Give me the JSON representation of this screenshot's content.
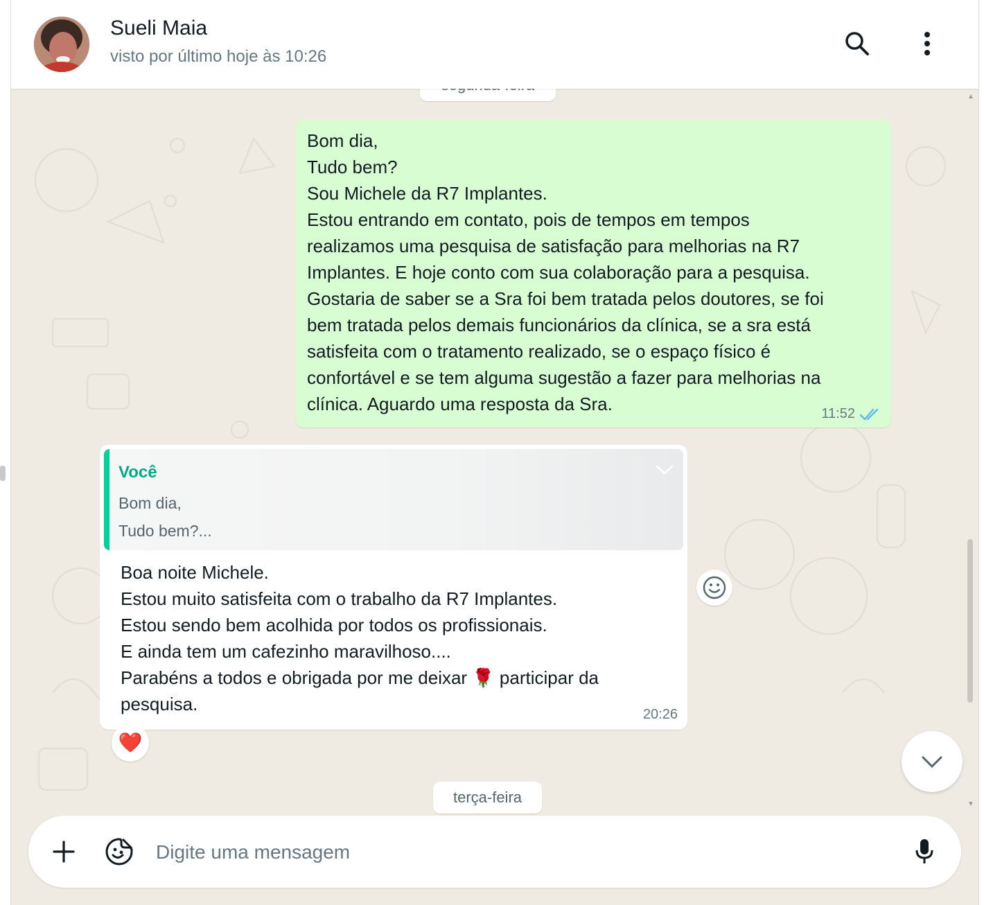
{
  "header": {
    "contact_name": "Sueli Maia",
    "last_seen": "visto por último hoje às 10:26",
    "icons": [
      "search-icon",
      "kebab-menu-icon"
    ]
  },
  "date_chips": {
    "previous_day": "segunda-feira",
    "next_day": "terça-feira"
  },
  "outgoing_message": {
    "text": "Bom dia,\nTudo bem?\nSou Michele da R7 Implantes.\nEstou entrando em contato, pois de tempos em tempos\nrealizamos uma  pesquisa de satisfação para melhorias na R7\nImplantes. E hoje conto com sua colaboração para a pesquisa.\nGostaria de saber se a Sra foi bem tratada pelos doutores, se foi\nbem tratada pelos demais funcionários da clínica, se a sra está\nsatisfeita com o tratamento realizado, se o espaço físico é\nconfortável e se tem alguma sugestão a fazer para melhorias na\nclínica. Aguardo uma resposta da Sra.",
    "time": "11:52",
    "status_icon": "double-check-read-icon",
    "colors": {
      "bubble": "#d9fdd3",
      "read_ticks": "#53bdeb"
    }
  },
  "incoming_message": {
    "quote": {
      "author": "Você",
      "text": "Bom dia,\nTudo bem?...",
      "accent": "#06cf9c"
    },
    "text_before_emoji": "Boa noite Michele.\nEstou muito satisfeita com o trabalho da R7 Implantes.\nEstou sendo bem acolhida por todos os profissionais.\nE ainda tem um cafezinho maravilhoso....\nParabéns a todos e obrigada por me deixar ",
    "emoji": "🌹",
    "text_after_emoji": " participar da\npesquisa.",
    "time": "20:26",
    "reaction": "❤️"
  },
  "composer": {
    "placeholder": "Digite uma mensagem",
    "icons": [
      "plus-icon",
      "sticker-icon",
      "mic-icon"
    ]
  }
}
